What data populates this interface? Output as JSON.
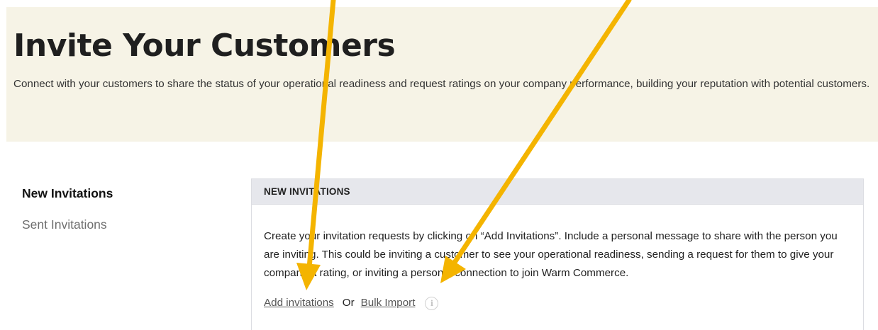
{
  "hero": {
    "title": "Invite Your Customers",
    "description": "Connect with your customers to share the status of your operational readiness and request ratings on your company performance, building your reputation with potential customers."
  },
  "sidebar": {
    "items": [
      {
        "label": "New Invitations",
        "active": true
      },
      {
        "label": "Sent Invitations",
        "active": false
      }
    ]
  },
  "card": {
    "header": "NEW INVITATIONS",
    "body": "Create your invitation requests by clicking on “Add Invitations”. Include a personal message to share with the person you are inviting. This could be inviting a customer to see your operational readiness, sending a request for them to give your company a rating, or inviting a personal connection to join Warm Commerce.",
    "add_link": "Add invitations",
    "or_text": "Or",
    "bulk_link": "Bulk Import",
    "info_glyph": "i"
  },
  "colors": {
    "hero_bg": "#f6f3e6",
    "header_bg": "#e6e7ec",
    "arrow": "#f4b400"
  },
  "icons": {
    "info": "info-icon",
    "annotation": "arrow-annotation"
  }
}
